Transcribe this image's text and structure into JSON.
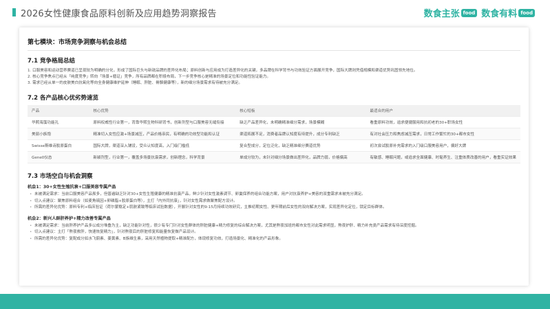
{
  "header": {
    "title": "2026女性健康食品原料创新及应用趋势洞察报告",
    "brand_one": "数食主张",
    "brand_one_badge": "food",
    "brand_two": "数食有料",
    "brand_two_badge": "food"
  },
  "module": {
    "title": "第七模块：市场竞争洞察与机会总结"
  },
  "section1": {
    "title": "7.1 竞争格局总结",
    "paragraphs": [
      "1. 口服美容和运动营养赛道已呈现较为明确的分化，形成了国际巨头与新锐品牌的差异化布局；原料创新与应用成为打造差异化的关键，多品牌在科学背书与功效验证方面展开竞争，国际大牌则凭借规模和渠道优势巩固领先地位。",
      "2. 核心竞争焦点已经从「纯度竞争」转向「场景+循证」竞争，所有品牌都在积极布局，下一步竞争核心是精准的场景定位和功能性验证能力。",
      "3. 需求已经从单一的皮肤美白抗氧化等向全身健康维护延伸（睡眠、肝脏、骨骼健康等），新的细分场景需求有待被充分满足。"
    ]
  },
  "section2": {
    "title": "7.2 各产品核心优劣势速览",
    "columns": [
      "产品",
      "核心优势",
      "核心短板",
      "最适合的用户"
    ],
    "rows": [
      [
        "华熙海藻功能孔",
        "原料权威性行业第一，背靠华熙生物科研背书，创新剂型与口服美容无缝衔接",
        "缺乏产品差异化，未明确精准细分需求，场景模糊",
        "看重原料功效，追求便捷服用和抗初老的30+职场女性"
      ],
      [
        "美丽小族饱",
        "精准切入女性应激+场景减压，产品价格亲民，有明确的功效型功能和认证",
        "渠道拓展不足，消费者品牌认知度有待提升，成分专利缺乏",
        "有对社会压力和焦虑减压需求，日常工作繁忙的30+都市女性"
      ],
      [
        "Swisse斯维诗胶原蛋白",
        "国际大牌，渠道深入铺设，受众认知度高，入门级门槛低",
        "复合型成分，定位泛化，缺乏精准细分赛道优势",
        "初次尝试胶原补充需求的入门级口服美容用户，偏好大牌"
      ],
      [
        "Gene0仪态",
        "新颖剂型，行业第一，覆盖多场景抗衰需求，创新理念，科学背景",
        "单成分较为，未针对细分场景做出差异化，品牌力弱，价格偏高",
        "有敏感、睡眠问题，或追求全面健康、时髦养生、注重体质改善的用户，看重实证效果"
      ]
    ]
  },
  "section3": {
    "title": "7.3 市场空白与机会洞察",
    "opportunities": [
      {
        "title": "机会1：30+女性生殖抗衰+口服美容专属产品",
        "bullets": [
          "未被满足需求：当前口服美容产品虽多，但普遍缺乏针对30+女性生殖健康的精准抗衰产品，鲜少针对女性激素调节、卵巢保养的组合功能方案，用户对抗衰养护+美容的双重需求未被充分满足。",
          "切入点建议：聚焦原料组合（如麦角硫因+卵磷脂+胶原蛋白等），主打「内外同抗衰」，针对女性需求做聚焦配方设计。",
          "所需的差异化优势：原料专利+临床验证（荷尔蒙稳定+肌肤紧致等临床试验数据），开展针对女性的9-15月持续功效研究，主推初期女性、更年期前后女性的双向解决方案，实现差异化定位，锁定目标群体。"
        ]
      },
      {
        "title": "机会2：新兴人群肝养护+精力改善专属产品",
        "bullets": [
          "未被满足需求：当前肝养护产品多以成分堆叠为主，缺乏功能针对性，很少有专门针对女性群体的肝脏健康+精力修复的综合解决方案，尤其是熬夜加班的都市女性对此需求明显，熬夜护肝、精力补充类产品需求有待深度挖掘。",
          "切入点建议：主打「熬夜救肝，快速恢复精力」，针对熬夜后的肝脏修复和能量恢复做产品设计。",
          "所需的差异化优势：复配成分如水飞蓟素、姜黄素、B族维生素，采用天然植物提取+精准配方，体现修复功效，打造场景化、精准化的产品形象。"
        ]
      }
    ]
  },
  "colors": {
    "accent": "#2fb3a3"
  }
}
